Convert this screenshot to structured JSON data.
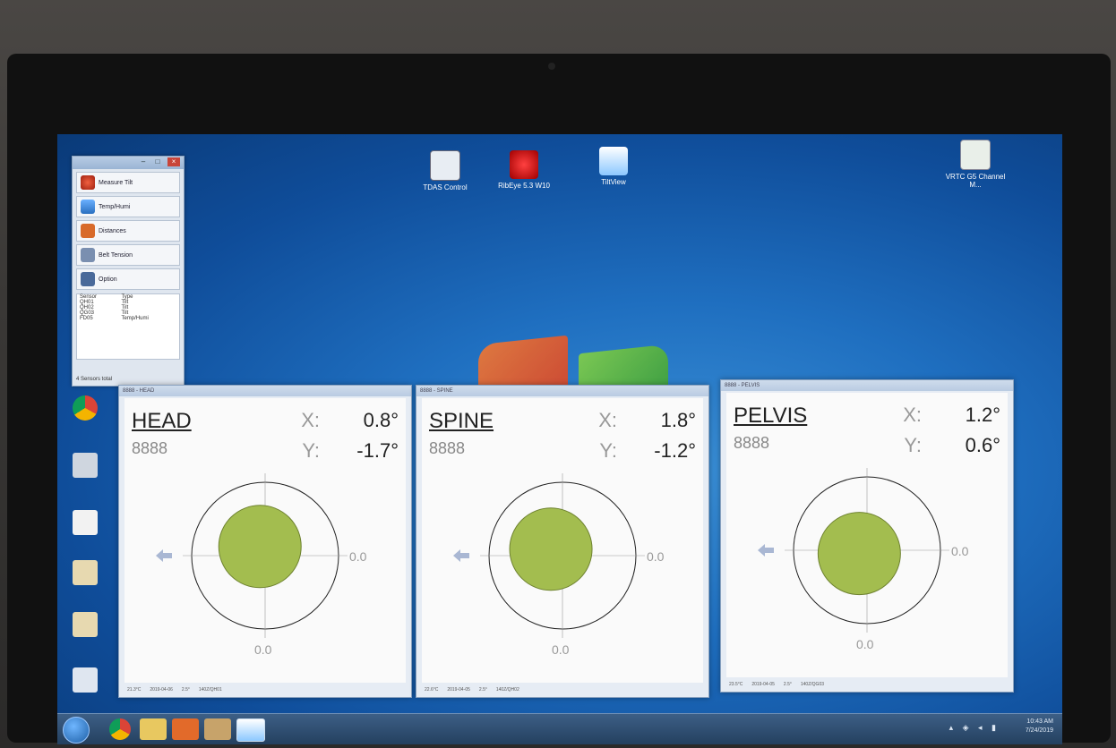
{
  "desktop_icons": [
    {
      "label": "TDAS Control"
    },
    {
      "label": "RibEye 5.3 W10"
    },
    {
      "label": "TiltView"
    },
    {
      "label": "VRTC G5 Channel M..."
    }
  ],
  "menu_window": {
    "items": [
      {
        "label": "Measure Tilt",
        "icon": "tilt-icon"
      },
      {
        "label": "Temp/Humi",
        "icon": "thermometer-icon"
      },
      {
        "label": "Distances",
        "icon": "distance-icon"
      },
      {
        "label": "Belt Tension",
        "icon": "belt-icon"
      },
      {
        "label": "Option",
        "icon": "option-icon"
      }
    ],
    "table": {
      "headers": [
        "Sensor",
        "Type"
      ],
      "rows": [
        [
          "QH01",
          "Tilt"
        ],
        [
          "QH02",
          "Tilt"
        ],
        [
          "QG03",
          "Tilt"
        ],
        [
          "FD05",
          "Temp/Humi"
        ]
      ]
    },
    "footer": "4 Sensors total"
  },
  "windows": [
    {
      "title": "8888 - HEAD",
      "name": "HEAD",
      "serial": "8888",
      "x_label": "X:",
      "x_value": "0.8°",
      "y_label": "Y:",
      "y_value": "-1.7°",
      "x_tilt": 0.8,
      "y_tilt": -1.7,
      "axis_x_label": "0.0",
      "axis_y_label": "0.0",
      "status": [
        "21.3°C",
        "2019-04-06",
        "2.5°",
        "140Z/QH01"
      ]
    },
    {
      "title": "8888 - SPINE",
      "name": "SPINE",
      "serial": "8888",
      "x_label": "X:",
      "x_value": "1.8°",
      "y_label": "Y:",
      "y_value": "-1.2°",
      "x_tilt": 1.8,
      "y_tilt": -1.2,
      "axis_x_label": "0.0",
      "axis_y_label": "0.0",
      "status": [
        "22.6°C",
        "2019-04-05",
        "2.5°",
        "140Z/QH02"
      ]
    },
    {
      "title": "8888 - PELVIS",
      "name": "PELVIS",
      "serial": "8888",
      "x_label": "X:",
      "x_value": "1.2°",
      "y_label": "Y:",
      "y_value": "0.6°",
      "x_tilt": 1.2,
      "y_tilt": 0.6,
      "axis_x_label": "0.0",
      "axis_y_label": "0.0",
      "status": [
        "23.5°C",
        "2019-04-05",
        "2.5°",
        "140Z/QG03"
      ]
    }
  ],
  "taskbar": {
    "time": "10:43 AM",
    "date": "7/24/2019"
  },
  "colors": {
    "bubble": "#a3bd4f",
    "bubble_stroke": "#6e8230",
    "arrow": "#a9b7d3"
  }
}
